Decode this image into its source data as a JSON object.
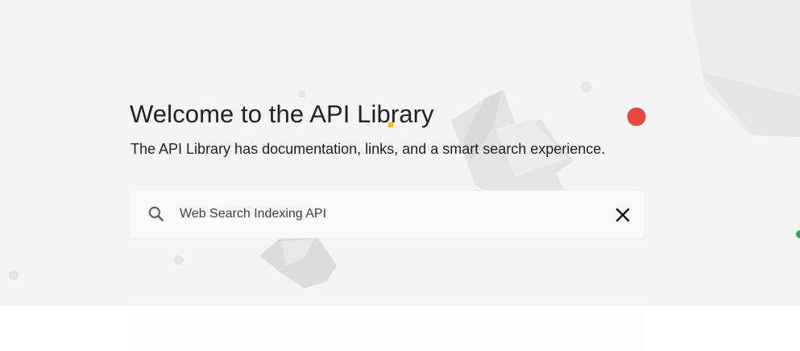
{
  "hero": {
    "title": "Welcome to the API Library",
    "subtitle": "The API Library has documentation, links, and a smart search experience."
  },
  "search": {
    "value": "Web Search Indexing API",
    "search_icon": "search-icon",
    "clear_icon": "close-icon"
  },
  "colors": {
    "hero_background": "#f4f4f5",
    "accent_red": "#e8453c",
    "accent_green": "#34a853",
    "accent_yellow": "#fbbc04",
    "text_primary": "#202124"
  }
}
